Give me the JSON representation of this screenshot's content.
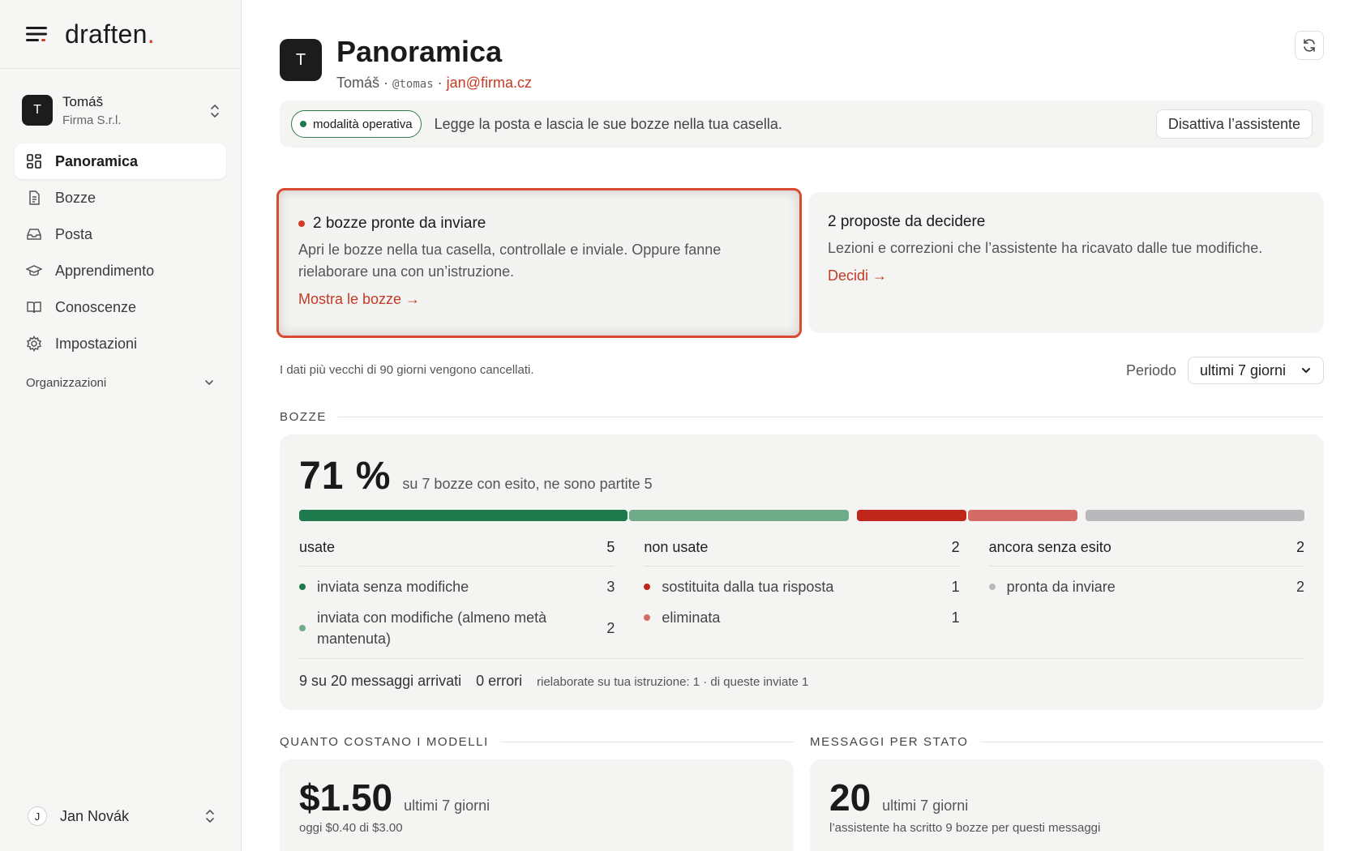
{
  "brand": {
    "name": "draften",
    "dot": "."
  },
  "account": {
    "initial": "T",
    "name": "Tomáš",
    "org": "Firma S.r.l."
  },
  "nav": [
    {
      "label": "Panoramica",
      "icon": "dashboard-icon",
      "active": true
    },
    {
      "label": "Bozze",
      "icon": "document-icon"
    },
    {
      "label": "Posta",
      "icon": "inbox-icon"
    },
    {
      "label": "Apprendimento",
      "icon": "graduation-cap-icon"
    },
    {
      "label": "Conoscenze",
      "icon": "book-icon"
    },
    {
      "label": "Impostazioni",
      "icon": "gear-icon"
    }
  ],
  "organizations": {
    "label": "Organizzazioni"
  },
  "user": {
    "initial": "J",
    "name": "Jan Novák"
  },
  "header": {
    "initial": "T",
    "title": "Panoramica",
    "name": "Tomáš",
    "sep1": "·",
    "handle": "@tomas",
    "sep2": "·",
    "email": "jan@firma.cz"
  },
  "mode": {
    "pill": "modalità operativa",
    "text": "Legge la posta e lascia le sue bozze nella tua casella.",
    "button": "Disattiva l’assistente"
  },
  "cards": {
    "drafts_ready": {
      "title": "2 bozze pronte da inviare",
      "desc": "Apri le bozze nella tua casella, controllale e inviale. Oppure fanne rielaborare una con un’istruzione.",
      "link": "Mostra le bozze →"
    },
    "proposals": {
      "title": "2 proposte da decidere",
      "desc": "Lezioni e correzioni che l’assistente ha ricavato dalle tue modifiche.",
      "link": "Decidi →"
    }
  },
  "retention": "I dati più vecchi di 90 giorni vengono cancellati.",
  "period": {
    "label": "Periodo",
    "selected": "ultimi 7 giorni"
  },
  "drafts_section": {
    "heading": "BOZZE",
    "percent": "71 %",
    "summary": "su 7 bozze con esito, ne sono partite 5",
    "bar": [
      {
        "value": 3,
        "color": "#1e7a4c"
      },
      {
        "value": 2,
        "color": "#6fab88"
      },
      {
        "value": 1,
        "color": "#c0261b"
      },
      {
        "value": 1,
        "color": "#d46b66"
      },
      {
        "value": 2,
        "color": "#b9b9bb"
      }
    ],
    "columns": [
      {
        "label": "usate",
        "count": "5",
        "rows": [
          {
            "label": "inviata senza modifiche",
            "count": "3",
            "color": "#1e7a4c"
          },
          {
            "label": "inviata con modifiche (almeno metà mantenuta)",
            "count": "2",
            "color": "#6fab88"
          }
        ]
      },
      {
        "label": "non usate",
        "count": "2",
        "rows": [
          {
            "label": "sostituita dalla tua risposta",
            "count": "1",
            "color": "#c0261b"
          },
          {
            "label": "eliminata",
            "count": "1",
            "color": "#d46b66"
          }
        ]
      },
      {
        "label": "ancora senza esito",
        "count": "2",
        "rows": [
          {
            "label": "pronta da inviare",
            "count": "2",
            "color": "#b9b9bb"
          }
        ]
      }
    ],
    "footer": {
      "arrived_num": "9",
      "arrived_text": "su 20 messaggi arrivati",
      "errors": "0 errori",
      "reworked": "rielaborate su tua istruzione: 1 · di queste inviate 1"
    }
  },
  "cost_section": {
    "heading": "QUANTO COSTANO I MODELLI",
    "value": "$1.50",
    "unit": "ultimi 7 giorni",
    "sub": "oggi $0.40 di $3.00"
  },
  "messages_section": {
    "heading": "MESSAGGI PER STATO",
    "value": "20",
    "unit": "ultimi 7 giorni",
    "sub": "l’assistente ha scritto 9 bozze per questi messaggi"
  },
  "colors": {
    "accent_red": "#c43a24",
    "operational_green": "#2c7a4e"
  }
}
